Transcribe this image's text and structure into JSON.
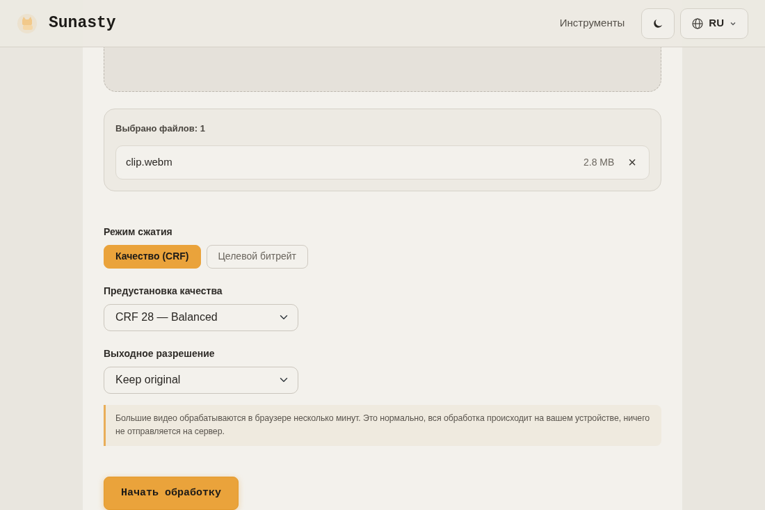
{
  "header": {
    "brand": "Sunasty",
    "nav_link": "Инструменты",
    "language": "RU"
  },
  "files": {
    "title": "Выбрано файлов: 1",
    "items": [
      {
        "name": "clip.webm",
        "size": "2.8 MB",
        "remove": "×"
      }
    ]
  },
  "mode": {
    "label": "Режим сжатия",
    "options": [
      {
        "label": "Качество (CRF)",
        "selected": true
      },
      {
        "label": "Целевой битрейт",
        "selected": false
      }
    ]
  },
  "preset": {
    "label": "Предустановка качества",
    "value": "CRF 28 — Balanced"
  },
  "resolution": {
    "label": "Выходное разрешение",
    "value": "Keep original"
  },
  "notice": "Большие видео обрабатываются в браузере несколько минут. Это нормально, вся обработка происходит на вашем устройстве, ничего не отправляется на сервер.",
  "start_button": "Начать обработку"
}
